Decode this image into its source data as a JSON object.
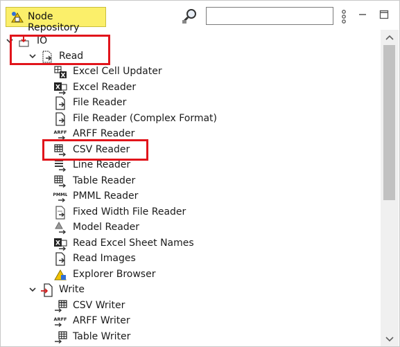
{
  "panel": {
    "tab_title": "Node Repository",
    "search": {
      "value": "",
      "placeholder": ""
    }
  },
  "colors": {
    "tab_bg": "#fbef6a",
    "highlight": "#e1141b",
    "scrollbar_thumb": "#c1c1c1"
  },
  "tree": {
    "io": {
      "label": "IO",
      "icon": "io-category-icon",
      "expanded": true,
      "read": {
        "label": "Read",
        "icon": "read-category-icon",
        "expanded": true,
        "items": [
          {
            "label": "Excel Cell Updater",
            "icon": "excel-cell-updater-icon"
          },
          {
            "label": "Excel Reader",
            "icon": "excel-reader-icon"
          },
          {
            "label": "File Reader",
            "icon": "file-reader-icon"
          },
          {
            "label": "File Reader (Complex Format)",
            "icon": "file-reader-complex-icon"
          },
          {
            "label": "ARFF Reader",
            "icon": "arff-reader-icon"
          },
          {
            "label": "CSV Reader",
            "icon": "csv-reader-icon"
          },
          {
            "label": "Line Reader",
            "icon": "line-reader-icon"
          },
          {
            "label": "Table Reader",
            "icon": "table-reader-icon"
          },
          {
            "label": "PMML Reader",
            "icon": "pmml-reader-icon"
          },
          {
            "label": "Fixed Width File Reader",
            "icon": "fixed-width-reader-icon"
          },
          {
            "label": "Model Reader",
            "icon": "model-reader-icon"
          },
          {
            "label": "Read Excel Sheet Names",
            "icon": "excel-sheet-names-icon"
          },
          {
            "label": "Read Images",
            "icon": "read-images-icon"
          },
          {
            "label": "Explorer Browser",
            "icon": "explorer-browser-icon"
          }
        ]
      },
      "write": {
        "label": "Write",
        "icon": "write-category-icon",
        "expanded": true,
        "items": [
          {
            "label": "CSV Writer",
            "icon": "csv-writer-icon"
          },
          {
            "label": "ARFF Writer",
            "icon": "arff-writer-icon"
          },
          {
            "label": "Table Writer",
            "icon": "table-writer-icon"
          }
        ]
      }
    }
  }
}
